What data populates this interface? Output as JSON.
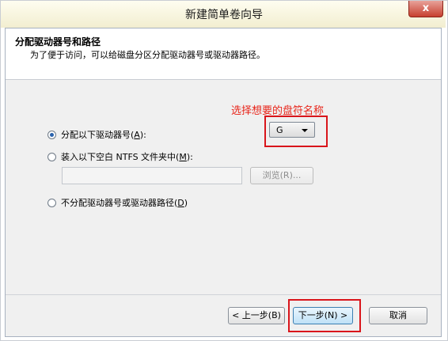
{
  "window": {
    "title": "新建简单卷向导",
    "close_glyph": "x"
  },
  "header": {
    "title": "分配驱动器号和路径",
    "subtitle": "为了便于访问，可以给磁盘分区分配驱动器号或驱动器路径。"
  },
  "annotation": {
    "text": "选择想要的盘符名称",
    "color": "#e8261b"
  },
  "options": {
    "assign_letter": {
      "label_prefix": "分配以下驱动器号(",
      "label_key": "A",
      "label_suffix": "):",
      "checked": true
    },
    "mount_folder": {
      "label_prefix": "装入以下空白 NTFS 文件夹中(",
      "label_key": "M",
      "label_suffix": "):",
      "checked": false
    },
    "no_assign": {
      "label_prefix": "不分配驱动器号或驱动器路径(",
      "label_key": "D",
      "label_suffix": ")",
      "checked": false
    }
  },
  "drive_letter": {
    "value": "G"
  },
  "browse_button": {
    "label": "浏览(R)..."
  },
  "footer": {
    "back_label": "< 上一步(B)",
    "next_label": "下一步(N) >",
    "cancel_label": "取消"
  },
  "colors": {
    "callout_border": "#d9151b",
    "radio_dot": "#2a63ad"
  }
}
